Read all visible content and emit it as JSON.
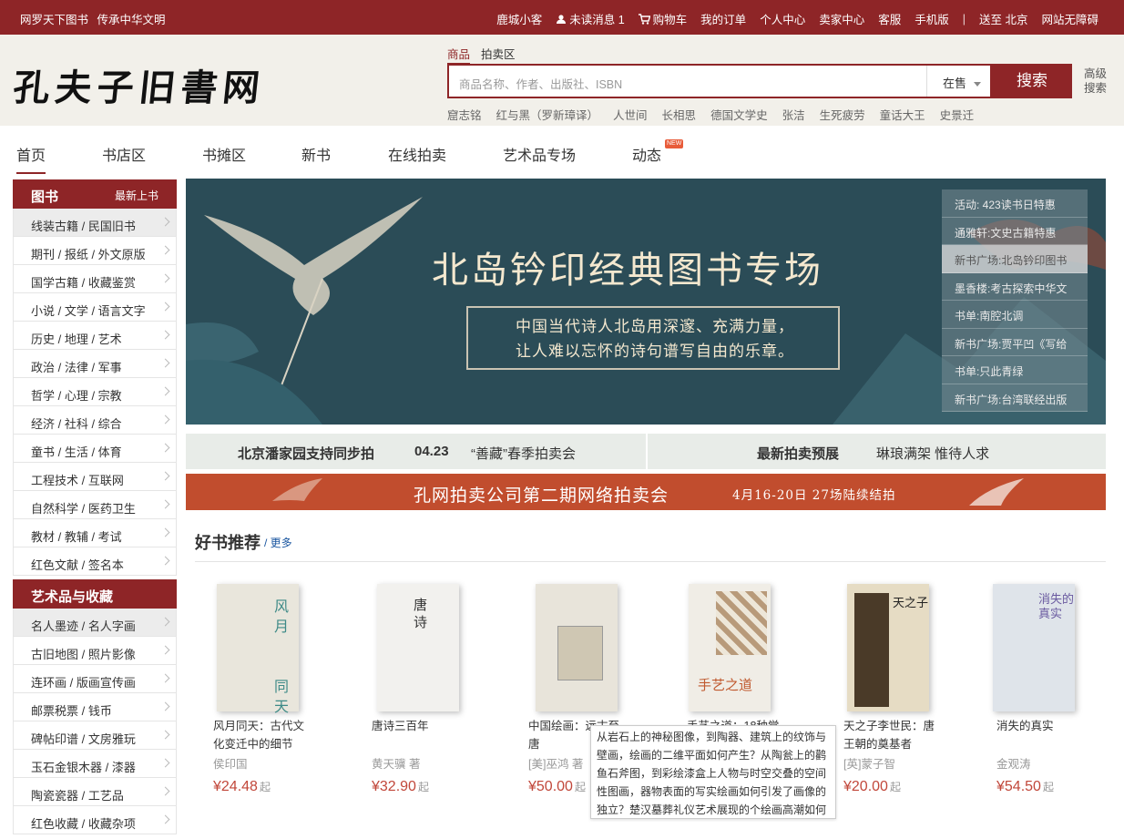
{
  "topbar": {
    "slogan": [
      "网罗天下图书",
      "传承中华文明"
    ],
    "links": [
      "鹿城小客",
      "未读消息 1",
      "购物车",
      "我的订单",
      "个人中心",
      "卖家中心",
      "客服",
      "手机版",
      "|",
      "送至 北京",
      "网站无障碍"
    ]
  },
  "header": {
    "logo": "孔夫子旧書网",
    "search_tabs": [
      "商品",
      "拍卖区"
    ],
    "search_placeholder": "商品名称、作者、出版社、ISBN",
    "scope": "在售",
    "search_button": "搜索",
    "advanced": "高级搜索",
    "hot": [
      "窟志铭",
      "红与黑（罗新璋译）",
      "人世间",
      "长相思",
      "德国文学史",
      "张洁",
      "生死疲劳",
      "童话大王",
      "史景迁"
    ]
  },
  "nav": {
    "items": [
      "首页",
      "书店区",
      "书摊区",
      "新书",
      "在线拍卖",
      "艺术品专场",
      "动态"
    ],
    "new_badge": "NEW"
  },
  "sidebar": {
    "books": {
      "title": "图书",
      "extra": "最新上书",
      "items": [
        "线装古籍 / 民国旧书",
        "期刊 / 报纸 / 外文原版",
        "国学古籍 / 收藏鉴赏",
        "小说 / 文学 / 语言文字",
        "历史 / 地理 / 艺术",
        "政治 / 法律 / 军事",
        "哲学 / 心理 / 宗教",
        "经济 / 社科 / 综合",
        "童书 / 生活 / 体育",
        "工程技术 / 互联网",
        "自然科学 / 医药卫生",
        "教材 / 教辅 / 考试",
        "红色文献 / 签名本"
      ]
    },
    "art": {
      "title": "艺术品与收藏",
      "items": [
        "名人墨迹 / 名人字画",
        "古旧地图 / 照片影像",
        "连环画 / 版画宣传画",
        "邮票税票 / 钱币",
        "碑帖印谱 / 文房雅玩",
        "玉石金银木器 / 漆器",
        "陶瓷瓷器 / 工艺品",
        "红色收藏 / 收藏杂项"
      ]
    }
  },
  "banner": {
    "title": "北岛钤印经典图书专场",
    "subtitle_1": "中国当代诗人北岛用深邃、充满力量，",
    "subtitle_2": "让人难以忘怀的诗句谱写自由的乐章。",
    "list": [
      "活动: 423读书日特惠",
      "通雅轩:文史古籍特惠",
      "新书广场:北岛钤印图书",
      "墨香楼:考古探索中华文",
      "书单:南腔北调",
      "新书广场:贾平凹《写给",
      "书单:只此青绿",
      "新书广场:台湾联经出版"
    ]
  },
  "strips": {
    "s1_a": "北京潘家园支持同步拍",
    "s1_b": "04.23",
    "s1_c": "“善藏”春季拍卖会",
    "s2_a": "最新拍卖预展",
    "s2_b": "琳琅满架 惟待人求",
    "s3_a": "孔网拍卖公司第二期网络拍卖会",
    "s3_b": "4月16-20日  27场陆续结拍"
  },
  "good_books": {
    "title": "好书推荐",
    "more": "/ 更多",
    "books": [
      {
        "title": "风月同天：古代文化变迁中的细节",
        "author": "侯印国",
        "price": "¥24.48",
        "suffix": "起",
        "cover_color": "#e9e6dc"
      },
      {
        "title": "唐诗三百年",
        "author": "黄天骥 著",
        "price": "¥32.90",
        "suffix": "起",
        "cover_color": "#f2f1ee"
      },
      {
        "title": "中国绘画：远古至唐",
        "author": "[美]巫鸿 著",
        "price": "¥50.00",
        "suffix": "起",
        "cover_color": "#e8e4da"
      },
      {
        "title": "手艺之道：18种觉醒与新生",
        "author": "",
        "price": "",
        "suffix": "",
        "cover_color": "#f0ede6"
      },
      {
        "title": "天之子李世民：唐王朝的奠基者",
        "author": "[英]蒙子智",
        "price": "¥20.00",
        "suffix": "起",
        "cover_color": "#e6dcc4"
      },
      {
        "title": "消失的真实",
        "author": "金观涛",
        "price": "¥54.50",
        "suffix": "起",
        "cover_color": "#dfe4ea"
      }
    ],
    "tooltip": "从岩石上的神秘图像，到陶器、建筑上的纹饰与壁画，绘画的二维平面如何产生？从陶瓮上的鹳鱼石斧图，到彩绘漆盒上人物与时空交叠的空间性图画，器物表面的写实绘画如何引发了画像的独立？楚汉墓葬礼仪艺术展现的个绘画高潮如何"
  }
}
